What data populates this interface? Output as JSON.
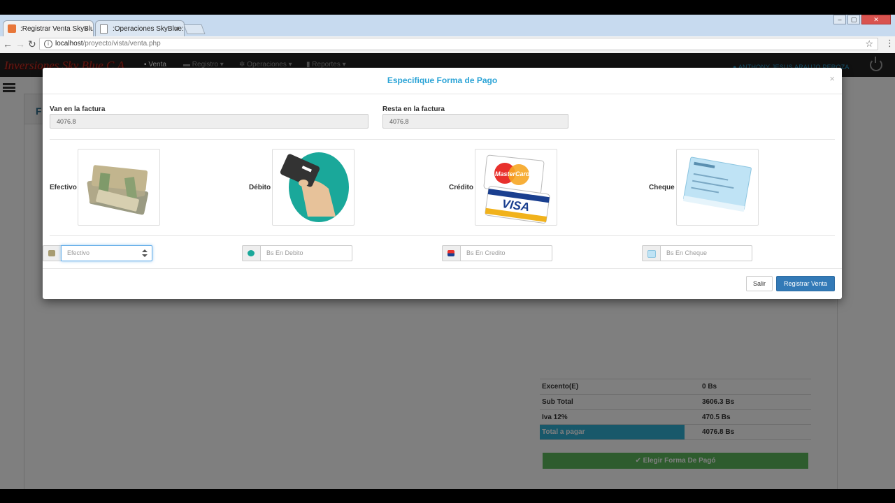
{
  "browser": {
    "tabs": [
      {
        "label": ":Registrar Venta SkyBlue",
        "close": "×"
      },
      {
        "label": ":Operaciones SkyBlue:",
        "close": "×"
      }
    ],
    "url_host": "localhost",
    "url_path": "/proyecto/vista/venta.php",
    "window_buttons": [
      "–",
      "▢",
      "✕"
    ]
  },
  "app": {
    "brand": "Inversiones Sky Blue C.A",
    "nav": [
      "Venta",
      "Registro ▾",
      "Operaciones ▾",
      "Reportes ▾"
    ],
    "user": "ANTHONY JESUS ARAUJO PEROZA",
    "panel_title": "F",
    "summary": [
      {
        "label": "Excento(E)",
        "value": "0 Bs"
      },
      {
        "label": "Sub Total",
        "value": "3606.3 Bs"
      },
      {
        "label": "Iva 12%",
        "value": "470.5 Bs"
      },
      {
        "label": "Total a pagar",
        "value": "4076.8 Bs"
      }
    ],
    "elegir_button": "✔ Elegir Forma De Pagó"
  },
  "modal": {
    "title": "Especifique Forma de Pago",
    "close": "×",
    "van_label": "Van en la factura",
    "van_value": "4076.8",
    "resta_label": "Resta en la factura",
    "resta_value": "4076.8",
    "methods": [
      {
        "label": "Efectivo",
        "icon": "cash-icon"
      },
      {
        "label": "Débito",
        "icon": "debit-card-icon"
      },
      {
        "label": "Crédito",
        "icon": "credit-card-icon"
      },
      {
        "label": "Cheque",
        "icon": "cheque-icon"
      }
    ],
    "inputs": [
      {
        "placeholder": "Efectivo",
        "icon": "cash-icon"
      },
      {
        "placeholder": "Bs En Debito",
        "icon": "debit-card-icon"
      },
      {
        "placeholder": "Bs En Credito",
        "icon": "credit-card-icon"
      },
      {
        "placeholder": "Bs En Cheque",
        "icon": "cheque-icon"
      }
    ],
    "salir": "Salir",
    "registrar": "Registrar Venta"
  }
}
